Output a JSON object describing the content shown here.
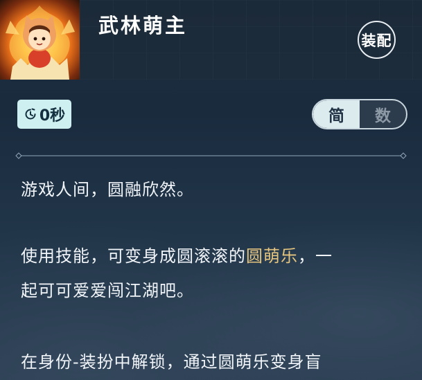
{
  "header": {
    "title": "武林萌主",
    "equip_button": "装配"
  },
  "timer": {
    "value": "0秒",
    "icon": "timer-icon"
  },
  "view_toggle": {
    "options": [
      "简",
      "数"
    ],
    "selected": "简"
  },
  "description": {
    "line1": "游戏人间，圆融欣然。",
    "line2_before": "使用技能，可变身成圆滚滚的",
    "line2_highlight": "圆萌乐",
    "line2_after": "，一",
    "line3": "起可可爱爱闯江湖吧。",
    "line4": "在身份-装扮中解锁，通过圆萌乐变身盲"
  },
  "colors": {
    "highlight": "#e6c57e",
    "chip_bg": "#cff0f1",
    "panel_bg": "#1c2d40"
  }
}
